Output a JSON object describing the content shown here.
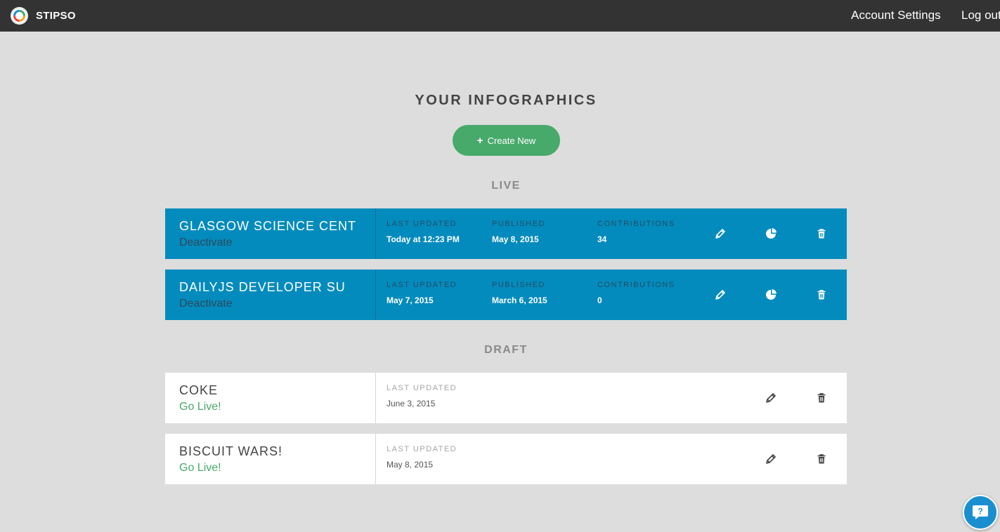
{
  "brand": {
    "name": "STIPSO"
  },
  "nav": {
    "account_settings": "Account Settings",
    "logout": "Log out"
  },
  "page": {
    "title": "YOUR INFOGRAPHICS",
    "create_label": "Create New",
    "create_icon": "plus-icon"
  },
  "sections": {
    "live": "LIVE",
    "draft": "DRAFT"
  },
  "live": [
    {
      "title": "GLASGOW SCIENCE CENT",
      "action": "Deactivate",
      "last_updated_label": "LAST UPDATED",
      "last_updated": "Today at 12:23 PM",
      "published_label": "PUBLISHED",
      "published": "May 8, 2015",
      "contributions_label": "CONTRIBUTIONS",
      "contributions": "34"
    },
    {
      "title": "DAILYJS DEVELOPER SU",
      "action": "Deactivate",
      "last_updated_label": "LAST UPDATED",
      "last_updated": "May 7, 2015",
      "published_label": "PUBLISHED",
      "published": "March 6, 2015",
      "contributions_label": "CONTRIBUTIONS",
      "contributions": "0"
    }
  ],
  "draft": [
    {
      "title": "COKE",
      "action": "Go Live!",
      "last_updated_label": "LAST UPDATED",
      "last_updated": "June 3, 2015"
    },
    {
      "title": "BISCUIT WARS!",
      "action": "Go Live!",
      "last_updated_label": "LAST UPDATED",
      "last_updated": "May 8, 2015"
    }
  ],
  "colors": {
    "topbar": "#333333",
    "background": "#dddddd",
    "live_card": "#048bbd",
    "accent_green": "#47a96a",
    "help": "#1a8fd0"
  },
  "icons": [
    "pencil-icon",
    "pie-chart-icon",
    "trash-icon",
    "help-icon",
    "logo-icon"
  ]
}
